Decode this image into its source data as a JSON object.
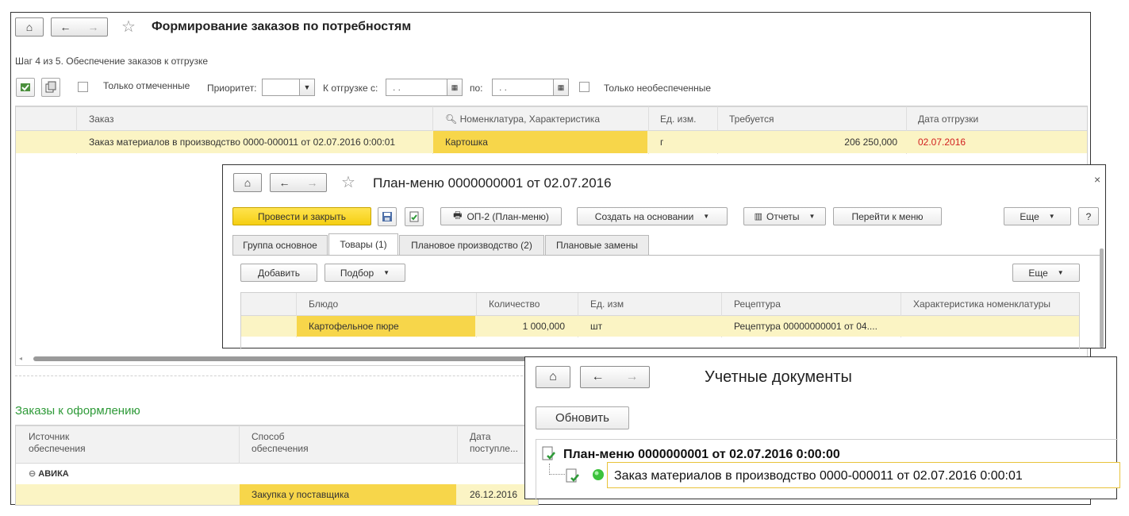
{
  "main": {
    "title": "Формирование заказов по потребностям",
    "step": "Шаг 4 из 5. Обеспечение заказов к отгрузке",
    "filters": {
      "only_marked": "Только отмеченные",
      "priority_label": "Приоритет:",
      "ship_from_label": "К отгрузке с:",
      "date_placeholder": " .  .",
      "to_label": "по:",
      "only_unsecured": "Только необеспеченные"
    },
    "grid": {
      "columns": [
        "Заказ",
        "Номенклатура, Характеристика",
        "Ед. изм.",
        "Требуется",
        "Дата отгрузки"
      ],
      "rows": [
        {
          "order": "Заказ материалов в производство 0000-000011 от 02.07.2016 0:00:01",
          "nomenclature": "Картошка",
          "unit": "г",
          "required": "206 250,000",
          "ship_date": "02.07.2016"
        }
      ]
    },
    "orders_section": {
      "title": "Заказы к оформлению",
      "columns": [
        "Источник\nобеспечения",
        "Способ\nобеспечения",
        "Дата\nпоступле..."
      ],
      "group": "АВИКА",
      "rows": [
        {
          "source": "",
          "method": "Закупка у поставщика",
          "date": "26.12.2016"
        }
      ]
    }
  },
  "plan_menu": {
    "title": "План-меню 0000000001 от 02.07.2016",
    "toolbar": {
      "post_close": "Провести и закрыть",
      "op2": "ОП-2 (План-меню)",
      "create_based": "Создать на основании",
      "reports": "Отчеты",
      "goto_menu": "Перейти к меню",
      "more": "Еще",
      "help": "?"
    },
    "tabs": [
      "Группа основное",
      "Товары (1)",
      "Плановое производство (2)",
      "Плановые замены"
    ],
    "sub_toolbar": {
      "add": "Добавить",
      "select": "Подбор",
      "more": "Еще"
    },
    "grid": {
      "columns": [
        "Блюдо",
        "Количество",
        "Ед. изм",
        "Рецептура",
        "Характеристика номенклатуры"
      ],
      "rows": [
        {
          "dish": "Картофельное пюре",
          "qty": "1 000,000",
          "unit": "шт",
          "recipe": "Рецептура 00000000001 от 04....",
          "characteristic": ""
        }
      ]
    },
    "close": "×"
  },
  "accounting_docs": {
    "title": "Учетные документы",
    "refresh": "Обновить",
    "tree": {
      "root": "План-меню 0000000001 от 02.07.2016 0:00:00",
      "child": "Заказ материалов в производство 0000-000011 от 02.07.2016 0:00:01"
    }
  },
  "colors": {
    "accent_yellow": "#f7d64a",
    "selected_row": "#fbf4c4",
    "section_green": "#2e9a38",
    "date_red": "#d11f1f"
  },
  "icons": [
    "home-icon",
    "back-icon",
    "forward-icon",
    "star-icon",
    "save-icon",
    "calendar-icon",
    "print-icon",
    "report-icon",
    "document-icon",
    "green-dot-icon"
  ]
}
